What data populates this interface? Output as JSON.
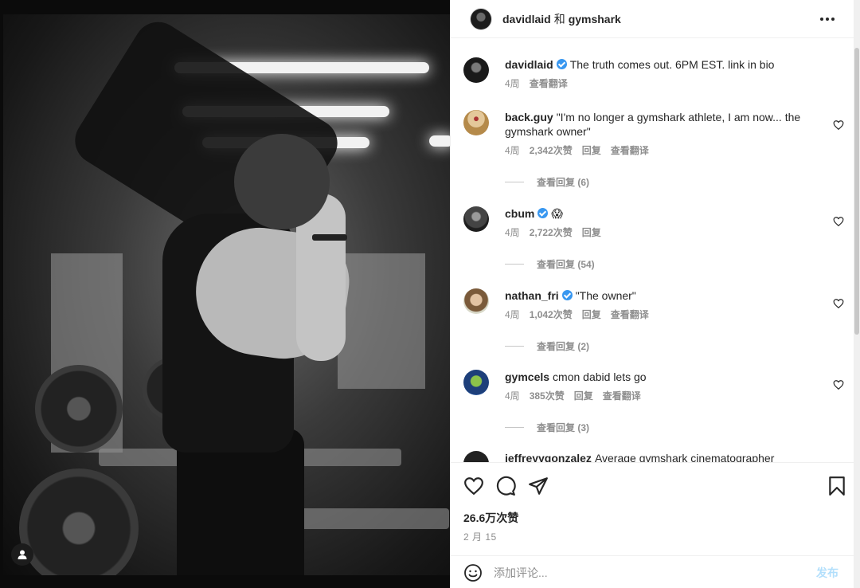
{
  "header": {
    "user1": "davidlaid",
    "separator": "和",
    "user2": "gymshark"
  },
  "comments": [
    {
      "username": "davidlaid",
      "verified": true,
      "text": "The truth comes out. 6PM EST. link in bio",
      "time": "4周",
      "likes": "",
      "reply": "",
      "translate": "查看翻译",
      "view_replies": "",
      "avatar_color": "#2a2a2a"
    },
    {
      "username": "back.guy",
      "verified": false,
      "text": "\"I'm no longer a gymshark athlete, I am now... the gymshark owner\"",
      "time": "4周",
      "likes": "2,342次赞",
      "reply": "回复",
      "translate": "查看翻译",
      "view_replies": "查看回复 (6)",
      "avatar_color": "#c9a56a"
    },
    {
      "username": "cbum",
      "verified": true,
      "text": "😱",
      "time": "4周",
      "likes": "2,722次赞",
      "reply": "回复",
      "translate": "",
      "view_replies": "查看回复 (54)",
      "avatar_color": "#3a3a3a"
    },
    {
      "username": "nathan_fri",
      "verified": true,
      "text": "\"The owner\"",
      "time": "4周",
      "likes": "1,042次赞",
      "reply": "回复",
      "translate": "查看翻译",
      "view_replies": "查看回复 (2)",
      "avatar_color": "#8a6a4a"
    },
    {
      "username": "gymcels",
      "verified": false,
      "text": "cmon dabid lets go",
      "time": "4周",
      "likes": "385次赞",
      "reply": "回复",
      "translate": "查看翻译",
      "view_replies": "查看回复 (3)",
      "avatar_color": "#2f5fa8"
    },
    {
      "username": "jeffreyygonzalez",
      "verified": false,
      "text": "Average gymshark cinematographer",
      "time": "",
      "likes": "",
      "reply": "",
      "translate": "",
      "view_replies": "",
      "avatar_color": "#222222"
    }
  ],
  "actions": {
    "like_icon": "heart-icon",
    "comment_icon": "comment-icon",
    "share_icon": "share-icon",
    "save_icon": "bookmark-icon"
  },
  "likes_text": "26.6万次赞",
  "date_text": "2 月 15",
  "add_comment": {
    "placeholder": "添加评论...",
    "post_label": "发布"
  },
  "colors": {
    "verified": "#3897f0",
    "muted": "#8e8e8e",
    "post_disabled": "#b2dffc"
  }
}
